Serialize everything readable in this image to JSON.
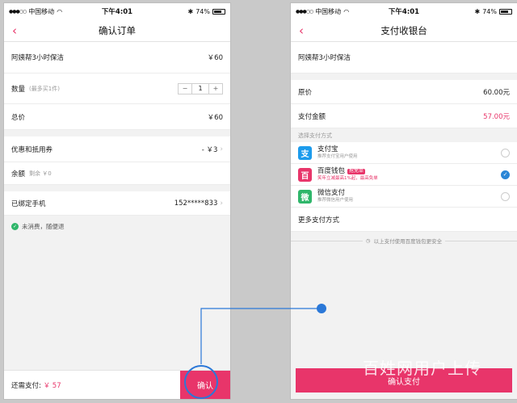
{
  "status": {
    "carrier": "中国移动",
    "time": "下午4:01",
    "battery": "74%"
  },
  "left": {
    "nav_title": "确认订单",
    "product": {
      "name": "阿姨帮3小时保洁",
      "price": "￥60"
    },
    "quantity": {
      "label": "数量",
      "hint": "(最多买1件)",
      "minus": "−",
      "value": "1",
      "plus": "+"
    },
    "total": {
      "label": "总价",
      "value": "￥60"
    },
    "coupon": {
      "label": "优惠和抵用券",
      "value": "- ￥3"
    },
    "balance": {
      "label": "余额",
      "hint": "剩余 ￥0"
    },
    "phone": {
      "label": "已绑定手机",
      "value": "152*****833"
    },
    "notice": "未消费，随便退",
    "bottom": {
      "due_label": "还需支付: ",
      "due_amount": "￥ 57",
      "confirm_label": "确认"
    }
  },
  "right": {
    "nav_title": "支付收银台",
    "product_name": "阿姨帮3小时保洁",
    "original": {
      "label": "原价",
      "value": "60.00元"
    },
    "pay_amount": {
      "label": "支付金额",
      "value": "57.00元"
    },
    "section_label": "选择支付方式",
    "methods": [
      {
        "name": "支付宝",
        "sub": "推荐支付宝用户使用",
        "icon": "alipay-icon",
        "color": "#1c9bec"
      },
      {
        "name": "百度钱包",
        "tag": "抢免单",
        "sub": "笑年立减最高1%起，最高免单",
        "icon": "baidu-wallet-icon",
        "color": "#e8356a",
        "selected": true
      },
      {
        "name": "微信支付",
        "sub": "推荐微信用户使用",
        "icon": "wechat-pay-icon",
        "color": "#2fb66a"
      }
    ],
    "more_methods": "更多支付方式",
    "secure_text": "以上支付使用百度钱包更安全",
    "pay_button": "确认支付"
  },
  "watermark": "百姓网用户上传",
  "colors": {
    "accent": "#e8356a",
    "callout": "#2b78d8"
  }
}
